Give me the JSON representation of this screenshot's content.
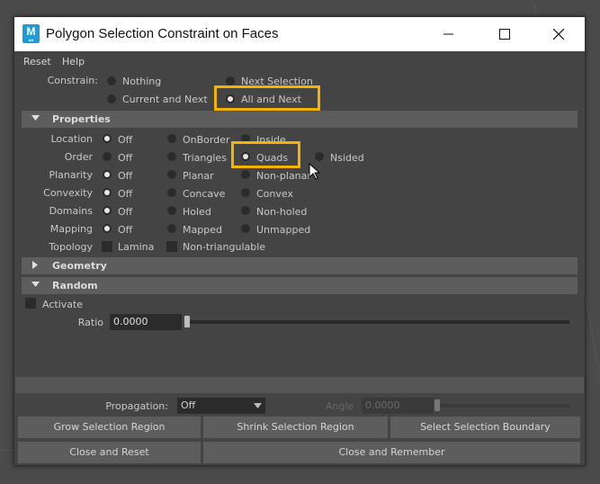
{
  "window": {
    "title": "Polygon Selection Constraint on Faces",
    "app_icon_letter": "M",
    "app_icon_sub": "AN"
  },
  "menu": {
    "reset": "Reset",
    "help": "Help"
  },
  "constrain": {
    "label": "Constrain:",
    "options": [
      "Nothing",
      "Next Selection",
      "Current and Next",
      "All and Next"
    ],
    "selected": "All and Next"
  },
  "sections": {
    "properties": "Properties",
    "geometry": "Geometry",
    "random": "Random"
  },
  "properties": {
    "location": {
      "label": "Location",
      "options": [
        "Off",
        "OnBorder",
        "Inside"
      ],
      "selected": "Off"
    },
    "order": {
      "label": "Order",
      "options": [
        "Off",
        "Triangles",
        "Quads",
        "Nsided"
      ],
      "selected": "Quads"
    },
    "planarity": {
      "label": "Planarity",
      "options": [
        "Off",
        "Planar",
        "Non-planar"
      ],
      "selected": "Off"
    },
    "convexity": {
      "label": "Convexity",
      "options": [
        "Off",
        "Concave",
        "Convex"
      ],
      "selected": "Off"
    },
    "domains": {
      "label": "Domains",
      "options": [
        "Off",
        "Holed",
        "Non-holed"
      ],
      "selected": "Off"
    },
    "mapping": {
      "label": "Mapping",
      "options": [
        "Off",
        "Mapped",
        "Unmapped"
      ],
      "selected": "Off"
    },
    "topology": {
      "label": "Topology",
      "options": [
        "Lamina",
        "Non-triangulable"
      ]
    }
  },
  "random": {
    "activate": "Activate",
    "ratio_label": "Ratio",
    "ratio_value": "0.0000",
    "ratio_fraction": 0.0
  },
  "propagation": {
    "label": "Propagation:",
    "value": "Off",
    "angle_label": "Angle",
    "angle_value": "0.0000"
  },
  "buttons": {
    "grow": "Grow Selection Region",
    "shrink": "Shrink Selection Region",
    "boundary": "Select Selection Boundary",
    "close_reset": "Close and Reset",
    "close_remember": "Close and Remember"
  },
  "colors": {
    "highlight": "#f5b301",
    "panel": "#444444",
    "section": "#5d5d5d",
    "field": "#2b2b2b"
  }
}
